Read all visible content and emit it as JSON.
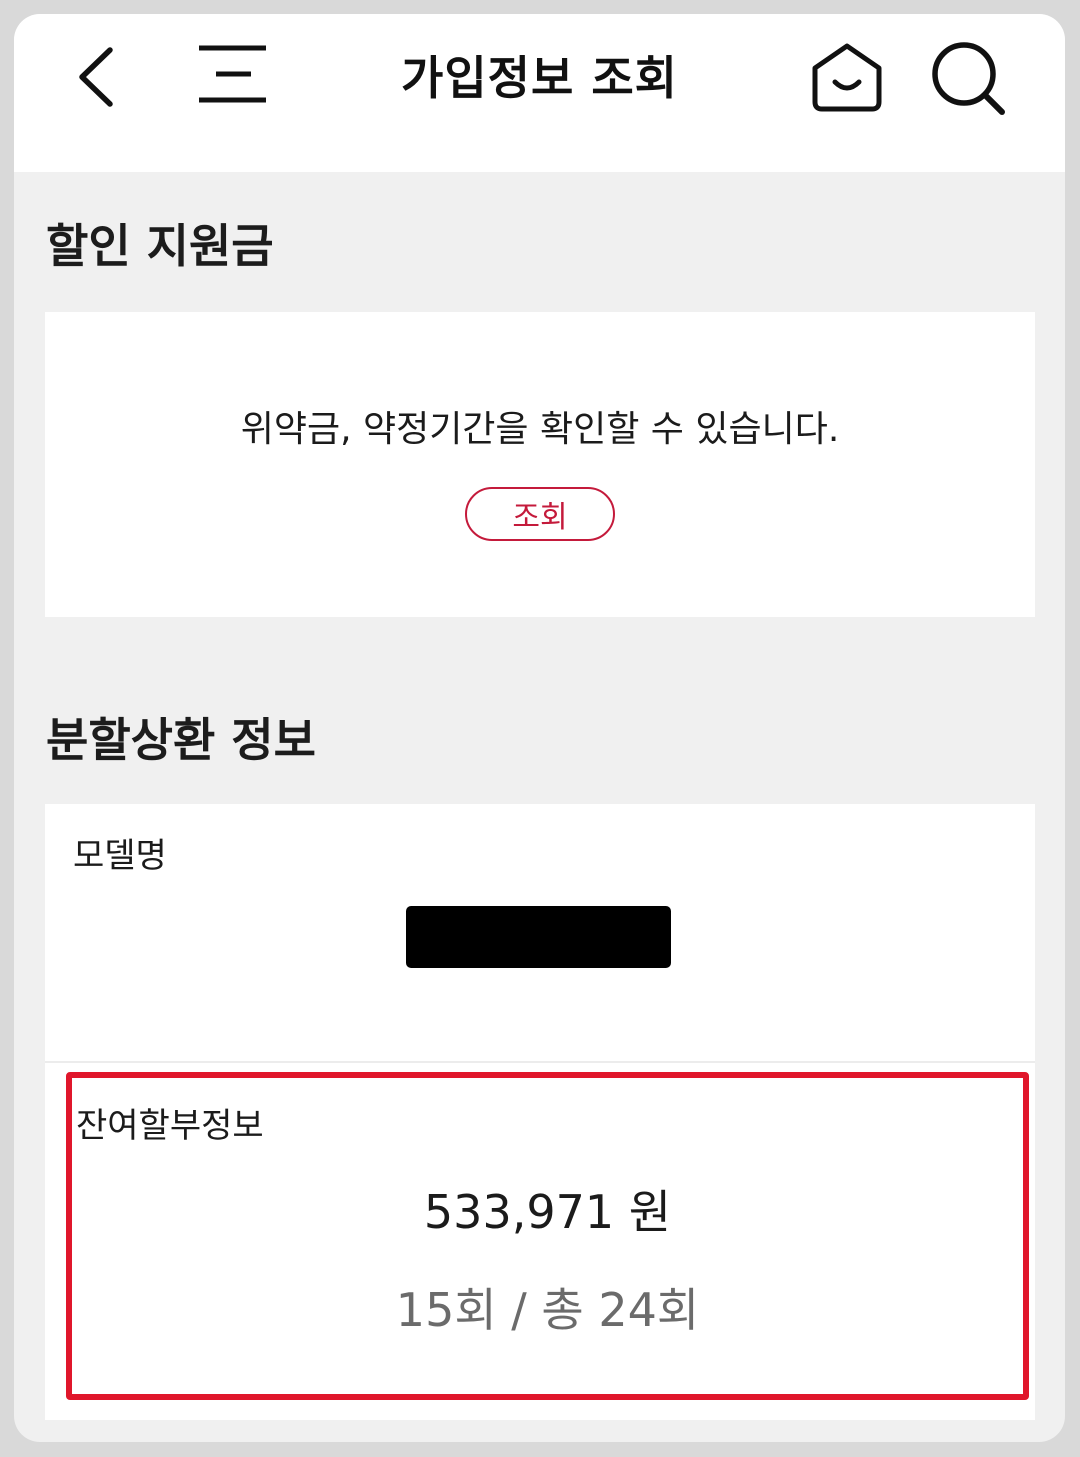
{
  "header": {
    "title": "가입정보 조회",
    "icons": [
      "chevron-left-icon",
      "menu-icon",
      "home-icon",
      "search-icon"
    ]
  },
  "discount": {
    "title": "할인 지원금",
    "description": "위약금, 약정기간을 확인할 수 있습니다.",
    "button_label": "조회"
  },
  "installment": {
    "title": "분할상환 정보",
    "model_label": "모델명",
    "remaining_label": "잔여할부정보",
    "amount": "533,971 원",
    "count": "15회 / 총 24회"
  },
  "colors": {
    "accent": "#c41a3b",
    "highlight": "#e0162b"
  }
}
